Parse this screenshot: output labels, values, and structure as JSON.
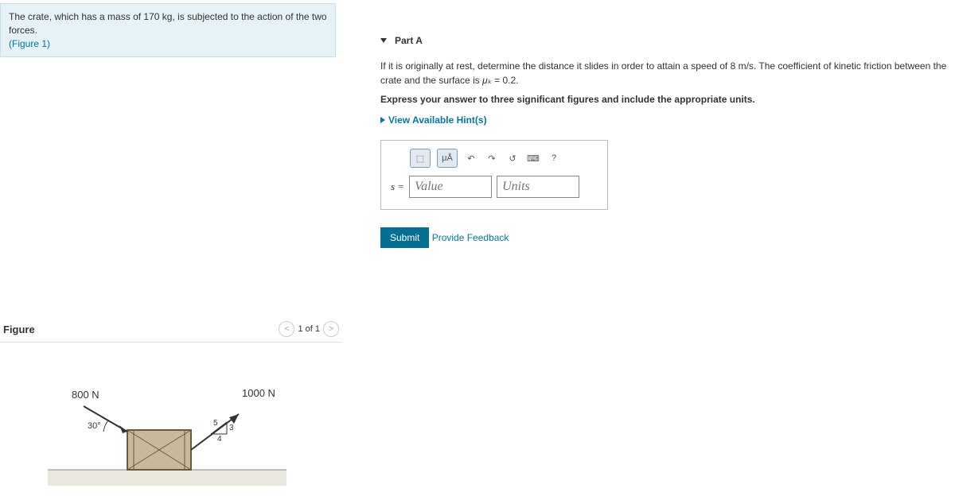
{
  "problem": {
    "line1_prefix": "The crate, which has a mass of ",
    "mass": "170 kg",
    "line1_suffix": ", is subjected to the action of the two forces.",
    "figure_link": "(Figure 1)"
  },
  "part": {
    "label": "Part A",
    "prompt_prefix": "If it is originally at rest, determine the distance it slides in order to attain a speed of ",
    "speed": "8 m/s",
    "prompt_mid": ". The coefficient of kinetic friction between the crate and the surface is ",
    "mu_symbol": "μₖ",
    "mu_eq": " = 0.2.",
    "express": "Express your answer to three significant figures and include the appropriate units.",
    "hints": "View Available Hint(s)"
  },
  "toolbar": {
    "template": "⬚",
    "special": "μÅ",
    "undo": "↶",
    "redo": "↷",
    "reset": "↺",
    "keyboard": "⌨",
    "help": "?"
  },
  "answer": {
    "var_label": "s =",
    "value_placeholder": "Value",
    "units_placeholder": "Units"
  },
  "submit": "Submit",
  "feedback": "Provide Feedback",
  "figure": {
    "title": "Figure",
    "counter": "1 of 1",
    "force1": "800 N",
    "angle": "30°",
    "force2": "1000 N",
    "tri_rise": "3",
    "tri_run": "4",
    "tri_hyp": "5"
  }
}
